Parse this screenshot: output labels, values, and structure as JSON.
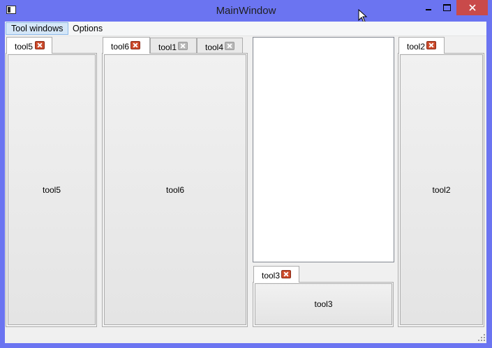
{
  "window": {
    "title": "MainWindow"
  },
  "menubar": {
    "items": [
      "Tool windows",
      "Options"
    ]
  },
  "docks": {
    "left": {
      "tabs": [
        "tool5"
      ],
      "content": "tool5"
    },
    "middle": {
      "tabs": [
        "tool6",
        "tool1",
        "tool4"
      ],
      "content": "tool6"
    },
    "bottom": {
      "tabs": [
        "tool3"
      ],
      "content": "tool3"
    },
    "right": {
      "tabs": [
        "tool2"
      ],
      "content": "tool2"
    }
  },
  "colors": {
    "titlebar": "#6b74f1",
    "close_button": "#c94a4a",
    "tab_close_active": "#cc4b2c",
    "menu_highlight": "#d5e7f8"
  },
  "icons": [
    "app-icon",
    "minimize-icon",
    "maximize-icon",
    "close-icon",
    "tab-close-icon",
    "size-grip-icon",
    "mouse-cursor-icon"
  ]
}
